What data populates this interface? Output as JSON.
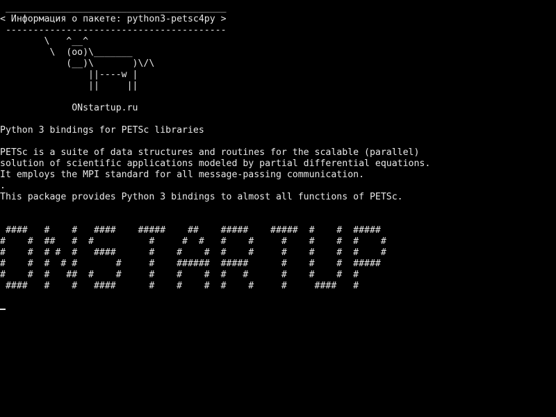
{
  "terminal": {
    "colors": {
      "background": "#000000",
      "foreground": "#e8e8e8"
    },
    "lines": [
      " ________________________________________",
      "< Информация о пакете: python3-petsc4py >",
      " ----------------------------------------",
      "        \\   ^__^",
      "         \\  (oo)\\_______",
      "            (__)\\       )\\/\\",
      "                ||----w |",
      "                ||     ||",
      "",
      "             ONstartup.ru",
      "",
      "Python 3 bindings for PETSc libraries",
      "",
      "PETSc is a suite of data structures and routines for the scalable (parallel)",
      "solution of scientific applications modeled by partial differential equations.",
      "It employs the MPI standard for all message-passing communication.",
      ".",
      "This package provides Python 3 bindings to almost all functions of PETSc.",
      "",
      "",
      " ####   #    #   ####    #####    ##    #####    #####  #    #  #####",
      "#    #  ##   #  #          #     #  #   #    #     #    #    #  #    #",
      "#    #  # #  #   ####      #    #    #  #    #     #    #    #  #    #",
      "#    #  #  # #       #     #    ######  #####      #    #    #  #####",
      "#    #  #   ##  #    #     #    #    #  #   #      #    #    #  #",
      " ####   #    #   ####      #    #    #  #    #     #     ####   #"
    ]
  }
}
